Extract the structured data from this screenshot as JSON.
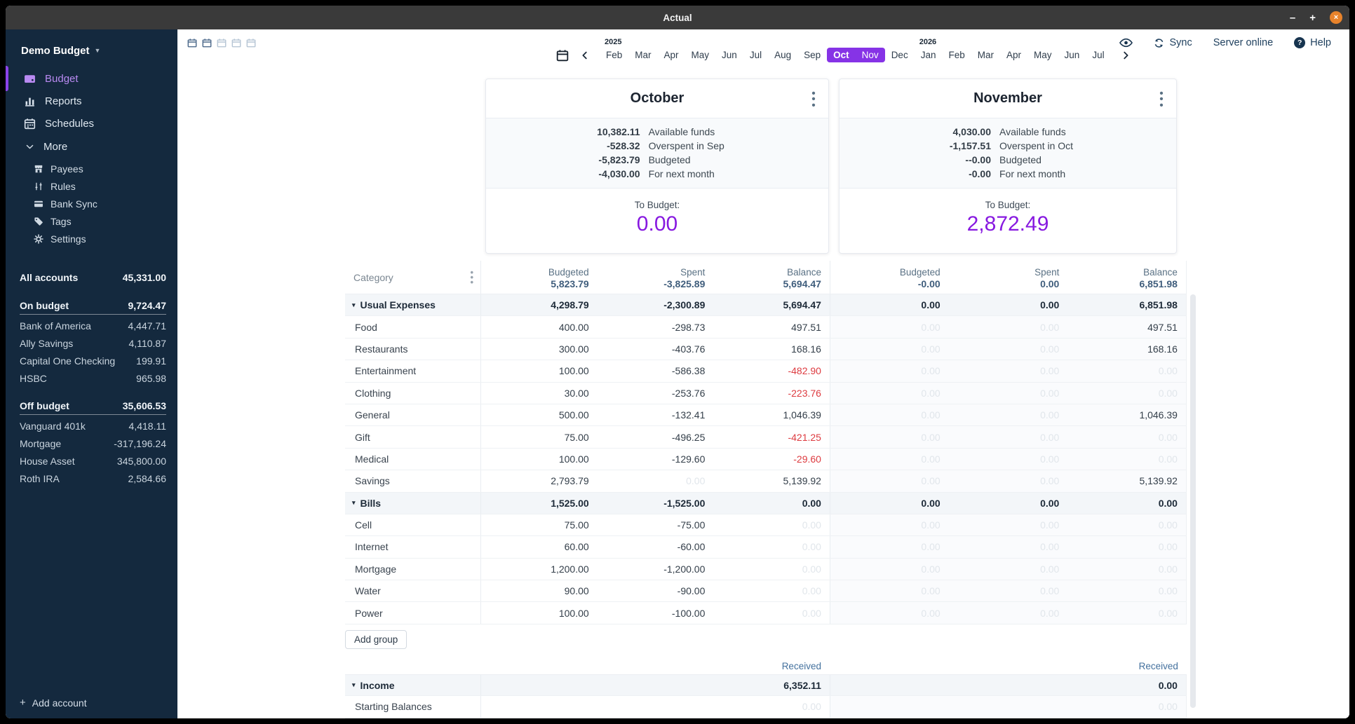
{
  "window": {
    "title": "Actual"
  },
  "titlebar": {
    "minimize": "–",
    "maximize": "+",
    "close": "×"
  },
  "sidebar": {
    "budget_name": "Demo Budget",
    "nav": [
      {
        "label": "Budget",
        "icon": "wallet-icon",
        "active": true
      },
      {
        "label": "Reports",
        "icon": "bar-chart-icon",
        "active": false
      },
      {
        "label": "Schedules",
        "icon": "calendar-icon",
        "active": false
      }
    ],
    "more_label": "More",
    "more_items": [
      {
        "label": "Payees",
        "icon": "store-icon"
      },
      {
        "label": "Rules",
        "icon": "sliders-icon"
      },
      {
        "label": "Bank Sync",
        "icon": "bank-card-icon"
      },
      {
        "label": "Tags",
        "icon": "tag-icon"
      },
      {
        "label": "Settings",
        "icon": "gear-icon"
      }
    ],
    "accounts": {
      "all_label": "All accounts",
      "all_value": "45,331.00",
      "groups": [
        {
          "label": "On budget",
          "value": "9,724.47",
          "accounts": [
            {
              "name": "Bank of America",
              "value": "4,447.71"
            },
            {
              "name": "Ally Savings",
              "value": "4,110.87"
            },
            {
              "name": "Capital One Checking",
              "value": "199.91"
            },
            {
              "name": "HSBC",
              "value": "965.98"
            }
          ]
        },
        {
          "label": "Off budget",
          "value": "35,606.53",
          "accounts": [
            {
              "name": "Vanguard 401k",
              "value": "4,418.11"
            },
            {
              "name": "Mortgage",
              "value": "-317,196.24"
            },
            {
              "name": "House Asset",
              "value": "345,800.00"
            },
            {
              "name": "Roth IRA",
              "value": "2,584.66"
            }
          ]
        }
      ]
    },
    "add_account_label": "Add account"
  },
  "toolbar": {
    "sync_label": "Sync",
    "server_status": "Server online",
    "help_label": "Help",
    "help_glyph": "?"
  },
  "monthnav": {
    "months": [
      {
        "label": "Feb",
        "year": "2025"
      },
      {
        "label": "Mar"
      },
      {
        "label": "Apr"
      },
      {
        "label": "May"
      },
      {
        "label": "Jun"
      },
      {
        "label": "Jul"
      },
      {
        "label": "Aug"
      },
      {
        "label": "Sep"
      },
      {
        "label": "Oct",
        "selected": true,
        "current": true
      },
      {
        "label": "Nov",
        "selected": true
      },
      {
        "label": "Dec"
      },
      {
        "label": "Jan",
        "year": "2026"
      },
      {
        "label": "Feb"
      },
      {
        "label": "Mar"
      },
      {
        "label": "Apr"
      },
      {
        "label": "May"
      },
      {
        "label": "Jun"
      },
      {
        "label": "Jul"
      }
    ]
  },
  "cards": [
    {
      "month": "October",
      "summary": [
        {
          "num": "10,382.11",
          "label": "Available funds"
        },
        {
          "num": "-528.32",
          "label": "Overspent in Sep"
        },
        {
          "num": "-5,823.79",
          "label": "Budgeted"
        },
        {
          "num": "-4,030.00",
          "label": "For next month"
        }
      ],
      "to_budget_label": "To Budget:",
      "to_budget": "0.00"
    },
    {
      "month": "November",
      "summary": [
        {
          "num": "4,030.00",
          "label": "Available funds"
        },
        {
          "num": "-1,157.51",
          "label": "Overspent in Oct"
        },
        {
          "num": "--0.00",
          "label": "Budgeted"
        },
        {
          "num": "-0.00",
          "label": "For next month"
        }
      ],
      "to_budget_label": "To Budget:",
      "to_budget": "2,872.49"
    }
  ],
  "table": {
    "category_header": "Category",
    "columns": [
      "Budgeted",
      "Spent",
      "Balance"
    ],
    "header_totals": {
      "oct": [
        "5,823.79",
        "-3,825.89",
        "5,694.47"
      ],
      "nov": [
        "-0.00",
        "0.00",
        "6,851.98"
      ]
    },
    "rows": [
      {
        "t": "group",
        "name": "Usual Expenses",
        "oct": [
          "4,298.79",
          "-2,300.89",
          "5,694.47"
        ],
        "ocs": [
          "n",
          "n",
          "n"
        ],
        "nov": [
          "0.00",
          "0.00",
          "6,851.98"
        ],
        "nvs": [
          "n",
          "n",
          "n"
        ]
      },
      {
        "t": "cat",
        "name": "Food",
        "oct": [
          "400.00",
          "-298.73",
          "497.51"
        ],
        "ocs": [
          "n",
          "n",
          "n"
        ],
        "nov": [
          "0.00",
          "0.00",
          "497.51"
        ],
        "nvs": [
          "f",
          "f",
          "n"
        ]
      },
      {
        "t": "cat",
        "name": "Restaurants",
        "oct": [
          "300.00",
          "-403.76",
          "168.16"
        ],
        "ocs": [
          "n",
          "n",
          "n"
        ],
        "nov": [
          "0.00",
          "0.00",
          "168.16"
        ],
        "nvs": [
          "f",
          "f",
          "n"
        ]
      },
      {
        "t": "cat",
        "name": "Entertainment",
        "oct": [
          "100.00",
          "-586.38",
          "-482.90"
        ],
        "ocs": [
          "n",
          "n",
          "r"
        ],
        "nov": [
          "0.00",
          "0.00",
          "0.00"
        ],
        "nvs": [
          "f",
          "f",
          "f"
        ]
      },
      {
        "t": "cat",
        "name": "Clothing",
        "oct": [
          "30.00",
          "-253.76",
          "-223.76"
        ],
        "ocs": [
          "n",
          "n",
          "r"
        ],
        "nov": [
          "0.00",
          "0.00",
          "0.00"
        ],
        "nvs": [
          "f",
          "f",
          "f"
        ]
      },
      {
        "t": "cat",
        "name": "General",
        "oct": [
          "500.00",
          "-132.41",
          "1,046.39"
        ],
        "ocs": [
          "n",
          "n",
          "n"
        ],
        "nov": [
          "0.00",
          "0.00",
          "1,046.39"
        ],
        "nvs": [
          "f",
          "f",
          "n"
        ]
      },
      {
        "t": "cat",
        "name": "Gift",
        "oct": [
          "75.00",
          "-496.25",
          "-421.25"
        ],
        "ocs": [
          "n",
          "n",
          "r"
        ],
        "nov": [
          "0.00",
          "0.00",
          "0.00"
        ],
        "nvs": [
          "f",
          "f",
          "f"
        ]
      },
      {
        "t": "cat",
        "name": "Medical",
        "oct": [
          "100.00",
          "-129.60",
          "-29.60"
        ],
        "ocs": [
          "n",
          "n",
          "r"
        ],
        "nov": [
          "0.00",
          "0.00",
          "0.00"
        ],
        "nvs": [
          "f",
          "f",
          "f"
        ]
      },
      {
        "t": "cat",
        "name": "Savings",
        "oct": [
          "2,793.79",
          "0.00",
          "5,139.92"
        ],
        "ocs": [
          "n",
          "f",
          "n"
        ],
        "nov": [
          "0.00",
          "0.00",
          "5,139.92"
        ],
        "nvs": [
          "f",
          "f",
          "n"
        ]
      },
      {
        "t": "group",
        "name": "Bills",
        "oct": [
          "1,525.00",
          "-1,525.00",
          "0.00"
        ],
        "ocs": [
          "n",
          "n",
          "n"
        ],
        "nov": [
          "0.00",
          "0.00",
          "0.00"
        ],
        "nvs": [
          "n",
          "n",
          "n"
        ]
      },
      {
        "t": "cat",
        "name": "Cell",
        "oct": [
          "75.00",
          "-75.00",
          "0.00"
        ],
        "ocs": [
          "n",
          "n",
          "f"
        ],
        "nov": [
          "0.00",
          "0.00",
          "0.00"
        ],
        "nvs": [
          "f",
          "f",
          "f"
        ]
      },
      {
        "t": "cat",
        "name": "Internet",
        "oct": [
          "60.00",
          "-60.00",
          "0.00"
        ],
        "ocs": [
          "n",
          "n",
          "f"
        ],
        "nov": [
          "0.00",
          "0.00",
          "0.00"
        ],
        "nvs": [
          "f",
          "f",
          "f"
        ]
      },
      {
        "t": "cat",
        "name": "Mortgage",
        "oct": [
          "1,200.00",
          "-1,200.00",
          "0.00"
        ],
        "ocs": [
          "n",
          "n",
          "f"
        ],
        "nov": [
          "0.00",
          "0.00",
          "0.00"
        ],
        "nvs": [
          "f",
          "f",
          "f"
        ]
      },
      {
        "t": "cat",
        "name": "Water",
        "oct": [
          "90.00",
          "-90.00",
          "0.00"
        ],
        "ocs": [
          "n",
          "n",
          "f"
        ],
        "nov": [
          "0.00",
          "0.00",
          "0.00"
        ],
        "nvs": [
          "f",
          "f",
          "f"
        ]
      },
      {
        "t": "cat",
        "name": "Power",
        "oct": [
          "100.00",
          "-100.00",
          "0.00"
        ],
        "ocs": [
          "n",
          "n",
          "f"
        ],
        "nov": [
          "0.00",
          "0.00",
          "0.00"
        ],
        "nvs": [
          "f",
          "f",
          "f"
        ]
      }
    ],
    "add_group_label": "Add group",
    "received_label": "Received",
    "income_rows": [
      {
        "t": "group",
        "name": "Income",
        "oct": "6,352.11",
        "os": "n",
        "nov": "0.00",
        "ns": "n"
      },
      {
        "t": "cat",
        "name": "Starting Balances",
        "oct": "0.00",
        "os": "f",
        "nov": "0.00",
        "ns": "f"
      }
    ]
  }
}
